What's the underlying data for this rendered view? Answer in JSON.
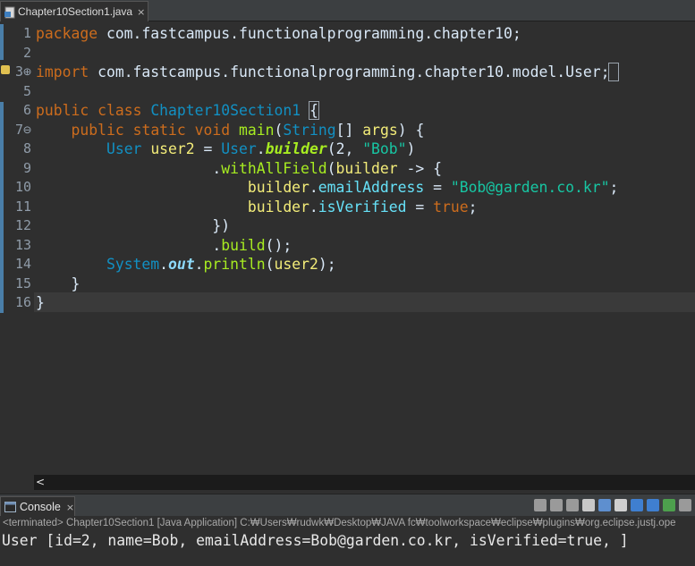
{
  "editor_tab": {
    "label": "Chapter10Section1.java",
    "close": "×"
  },
  "code_lines": [
    {
      "n": "1",
      "parts": [
        {
          "c": "kw",
          "t": "package"
        },
        {
          "c": "pl",
          "t": " com.fastcampus.functionalprogramming.chapter10;"
        }
      ]
    },
    {
      "n": "2",
      "parts": []
    },
    {
      "n": "3⊕",
      "parts": [
        {
          "c": "kw",
          "t": "import"
        },
        {
          "c": "pl",
          "t": " com.fastcampus.functionalprogramming.chapter10.model.User;"
        },
        {
          "c": "box",
          "t": " "
        }
      ]
    },
    {
      "n": "5",
      "parts": []
    },
    {
      "n": "6",
      "parts": [
        {
          "c": "kw",
          "t": "public"
        },
        {
          "c": "pl",
          "t": " "
        },
        {
          "c": "kw",
          "t": "class"
        },
        {
          "c": "pl",
          "t": " "
        },
        {
          "c": "ty",
          "t": "Chapter10Section1"
        },
        {
          "c": "pl",
          "t": " "
        },
        {
          "c": "box",
          "t": "{"
        }
      ]
    },
    {
      "n": "7⊖",
      "parts": [
        {
          "c": "pl",
          "t": "    "
        },
        {
          "c": "kw",
          "t": "public"
        },
        {
          "c": "pl",
          "t": " "
        },
        {
          "c": "kw",
          "t": "static"
        },
        {
          "c": "pl",
          "t": " "
        },
        {
          "c": "kw",
          "t": "void"
        },
        {
          "c": "pl",
          "t": " "
        },
        {
          "c": "mth",
          "t": "main"
        },
        {
          "c": "pl",
          "t": "("
        },
        {
          "c": "ty",
          "t": "String"
        },
        {
          "c": "pl",
          "t": "[] "
        },
        {
          "c": "var",
          "t": "args"
        },
        {
          "c": "pl",
          "t": ") {"
        }
      ]
    },
    {
      "n": "8",
      "parts": [
        {
          "c": "pl",
          "t": "        "
        },
        {
          "c": "ty",
          "t": "User"
        },
        {
          "c": "pl",
          "t": " "
        },
        {
          "c": "var",
          "t": "user2"
        },
        {
          "c": "pl",
          "t": " = "
        },
        {
          "c": "ty",
          "t": "User"
        },
        {
          "c": "pl",
          "t": "."
        },
        {
          "c": "sm",
          "t": "builder"
        },
        {
          "c": "pl",
          "t": "(2, "
        },
        {
          "c": "str",
          "t": "\"Bob\""
        },
        {
          "c": "pl",
          "t": ")"
        }
      ]
    },
    {
      "n": "9",
      "parts": [
        {
          "c": "pl",
          "t": "                    ."
        },
        {
          "c": "mth",
          "t": "withAllField"
        },
        {
          "c": "pl",
          "t": "("
        },
        {
          "c": "var",
          "t": "builder"
        },
        {
          "c": "pl",
          "t": " -> {"
        }
      ]
    },
    {
      "n": "10",
      "parts": [
        {
          "c": "pl",
          "t": "                        "
        },
        {
          "c": "var",
          "t": "builder"
        },
        {
          "c": "pl",
          "t": "."
        },
        {
          "c": "fld",
          "t": "emailAddress"
        },
        {
          "c": "pl",
          "t": " = "
        },
        {
          "c": "str",
          "t": "\"Bob@garden.co.kr\""
        },
        {
          "c": "pl",
          "t": ";"
        }
      ]
    },
    {
      "n": "11",
      "parts": [
        {
          "c": "pl",
          "t": "                        "
        },
        {
          "c": "var",
          "t": "builder"
        },
        {
          "c": "pl",
          "t": "."
        },
        {
          "c": "fld",
          "t": "isVerified"
        },
        {
          "c": "pl",
          "t": " = "
        },
        {
          "c": "kw",
          "t": "true"
        },
        {
          "c": "pl",
          "t": ";"
        }
      ]
    },
    {
      "n": "12",
      "parts": [
        {
          "c": "pl",
          "t": "                    })"
        }
      ]
    },
    {
      "n": "13",
      "parts": [
        {
          "c": "pl",
          "t": "                    ."
        },
        {
          "c": "mth",
          "t": "build"
        },
        {
          "c": "pl",
          "t": "();"
        }
      ]
    },
    {
      "n": "14",
      "parts": [
        {
          "c": "pl",
          "t": "        "
        },
        {
          "c": "ty",
          "t": "System"
        },
        {
          "c": "pl",
          "t": "."
        },
        {
          "c": "sf",
          "t": "out"
        },
        {
          "c": "pl",
          "t": "."
        },
        {
          "c": "mth",
          "t": "println"
        },
        {
          "c": "pl",
          "t": "("
        },
        {
          "c": "var",
          "t": "user2"
        },
        {
          "c": "pl",
          "t": ");"
        }
      ]
    },
    {
      "n": "15",
      "parts": [
        {
          "c": "pl",
          "t": "    }"
        }
      ]
    },
    {
      "n": "16",
      "parts": [
        {
          "c": "pl",
          "t": "}"
        }
      ]
    }
  ],
  "scroll_arrow": "<",
  "console_tab": {
    "label": "Console",
    "close": "×"
  },
  "console_description": "<terminated> Chapter10Section1 [Java Application] C:₩Users₩rudwk₩Desktop₩JAVA fc₩toolworkspace₩eclipse₩plugins₩org.eclipse.justj.ope",
  "console_output": "User [id=2, name=Bob, emailAddress=Bob@garden.co.kr, isVerified=true, ]",
  "toolbar_icons": [
    "terminate-icon",
    "remove-launch-icon",
    "remove-all-icon",
    "clear-console-icon",
    "scroll-lock-icon",
    "word-wrap-icon",
    "pin-console-icon",
    "show-stdout-icon",
    "open-console-icon",
    "view-menu-icon"
  ],
  "colors": {
    "background": "#2f2f2f",
    "keyword": "#cc6c1d",
    "type": "#1290c3",
    "method": "#a7ec21",
    "variable": "#f3ec79",
    "field": "#66e1f8",
    "string": "#17c6a3"
  }
}
